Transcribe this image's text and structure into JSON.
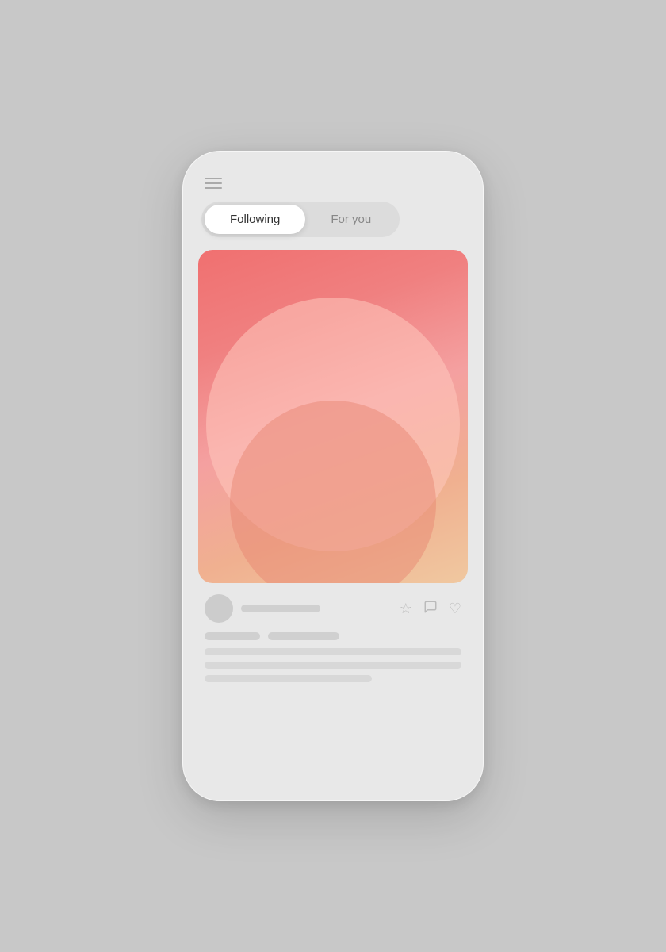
{
  "background_color": "#c8c8c8",
  "phone": {
    "tabs": [
      {
        "id": "following",
        "label": "Following",
        "active": true
      },
      {
        "id": "for_you",
        "label": "For you",
        "active": false
      }
    ],
    "hamburger_lines": 3,
    "post": {
      "gradient_colors": [
        "#f07070",
        "#f4a0a0",
        "#f0c8a0"
      ],
      "author_placeholder": "",
      "action_icons": {
        "bookmark": "★",
        "comment": "💬",
        "heart": "♥"
      }
    }
  }
}
